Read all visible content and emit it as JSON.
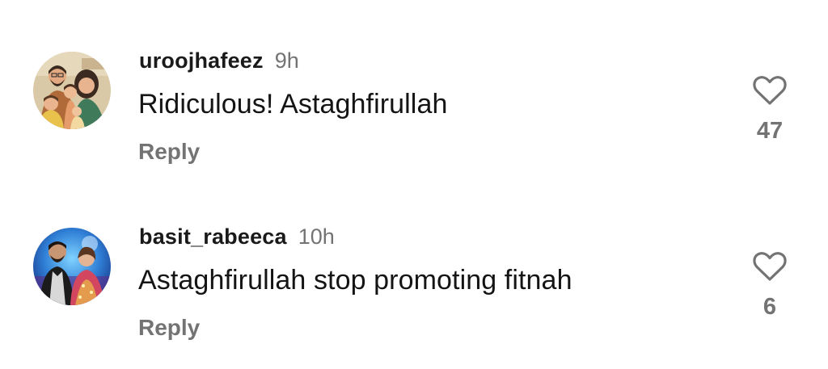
{
  "comments": [
    {
      "username": "uroojhafeez",
      "time": "9h",
      "text": "Ridiculous! Astaghfirullah",
      "reply_label": "Reply",
      "likes": "47",
      "avatar_icon": "family-illustration-avatar",
      "like_icon": "heart-outline-icon"
    },
    {
      "username": "basit_rabeeca",
      "time": "10h",
      "text": "Astaghfirullah stop promoting fitnah",
      "reply_label": "Reply",
      "likes": "6",
      "avatar_icon": "couple-photo-avatar",
      "like_icon": "heart-outline-icon"
    }
  ],
  "colors": {
    "text_primary": "#141414",
    "text_secondary": "#737373",
    "background": "#ffffff"
  }
}
